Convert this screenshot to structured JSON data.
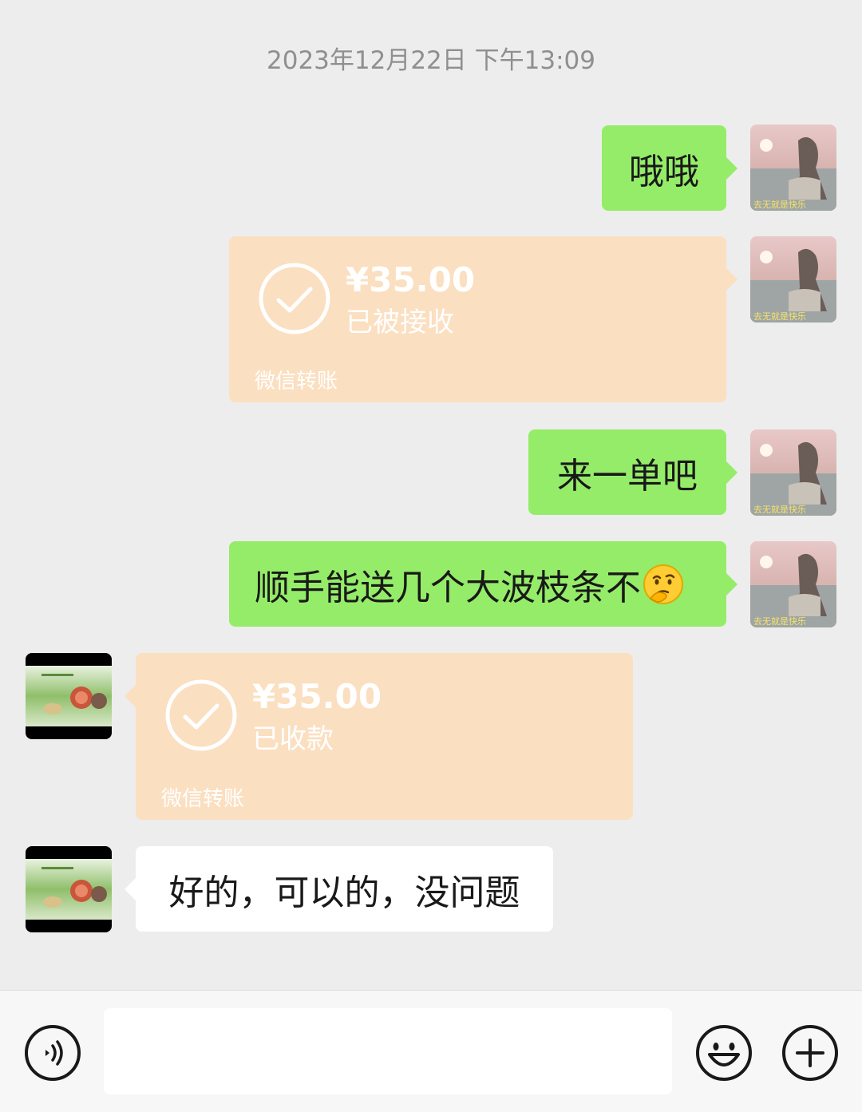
{
  "timestamp": "2023年12月22日 下午13:09",
  "messages": [
    {
      "side": "right",
      "type": "text",
      "text": "哦哦"
    },
    {
      "side": "right",
      "type": "transfer",
      "amount": "¥35.00",
      "status": "已被接收",
      "label": "微信转账"
    },
    {
      "side": "right",
      "type": "text",
      "text": "来一单吧"
    },
    {
      "side": "right",
      "type": "text",
      "text": "顺手能送几个大波枝条不",
      "emoji": "thinking-face-emoji"
    },
    {
      "side": "left",
      "type": "transfer",
      "amount": "¥35.00",
      "status": "已收款",
      "label": "微信转账"
    },
    {
      "side": "left",
      "type": "text",
      "text": "好的，可以的，没问题"
    }
  ],
  "input_bar": {
    "voice_icon": "voice-icon",
    "input_value": "",
    "emoji_icon": "smiley-icon",
    "plus_icon": "plus-icon"
  },
  "colors": {
    "background": "#ededed",
    "outgoing_bubble": "#95ec69",
    "incoming_bubble": "#ffffff",
    "transfer_card": "#fbdfc1",
    "timestamp_text": "#8f8f8f"
  }
}
